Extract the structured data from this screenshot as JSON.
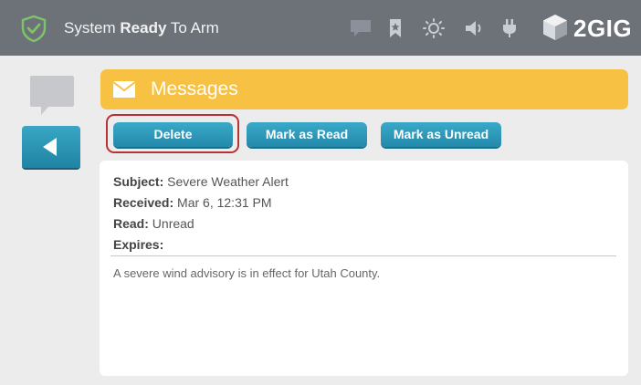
{
  "status_bar": {
    "text_prefix": "System ",
    "text_bold": "Ready",
    "text_suffix": " To Arm",
    "brand": "2GIG",
    "icons": [
      "shield-check-icon",
      "chat-icon",
      "bookmark-icon",
      "brightness-icon",
      "volume-icon",
      "power-plug-icon",
      "cube-logo-icon"
    ]
  },
  "nav": {
    "back_icon": "back-arrow-icon",
    "chat_icon": "chat-bubble-icon"
  },
  "messages_header": {
    "icon": "envelope-icon",
    "title": "Messages"
  },
  "actions": {
    "delete": "Delete",
    "mark_read": "Mark as Read",
    "mark_unread": "Mark as Unread"
  },
  "message": {
    "subject_label": "Subject:",
    "subject": "Severe Weather Alert",
    "received_label": "Received:",
    "received": "Mar 6, 12:31 PM",
    "read_label": "Read:",
    "read": "Unread",
    "expires_label": "Expires:",
    "expires": "",
    "body": "A severe wind advisory is in effect for Utah County."
  },
  "colors": {
    "top_bar": "#6d7279",
    "header": "#f7c143",
    "button": "#2a95b7",
    "highlight": "#b73333",
    "shield": "#7cc36a"
  }
}
